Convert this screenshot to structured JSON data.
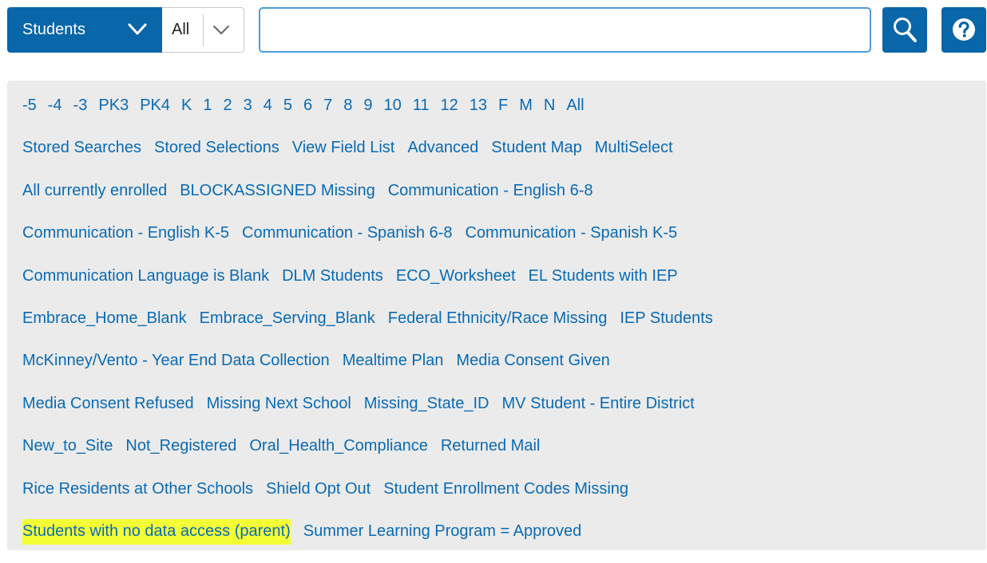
{
  "toolbar": {
    "scope_label": "Students",
    "grade_label": "All",
    "search_value": "",
    "search_icon": "magnifier-icon",
    "help_icon": "question-circle-icon"
  },
  "grade_links": [
    "-5",
    "-4",
    "-3",
    "PK3",
    "PK4",
    "K",
    "1",
    "2",
    "3",
    "4",
    "5",
    "6",
    "7",
    "8",
    "9",
    "10",
    "11",
    "12",
    "13",
    "F",
    "M",
    "N",
    "All"
  ],
  "search_rows": [
    [
      "Stored Searches",
      "Stored Selections",
      "View Field List",
      "Advanced",
      "Student Map",
      "MultiSelect"
    ],
    [
      "All currently enrolled",
      "BLOCKASSIGNED Missing",
      "Communication - English 6-8"
    ],
    [
      "Communication - English K-5",
      "Communication - Spanish 6-8",
      "Communication - Spanish K-5"
    ],
    [
      "Communication Language is Blank",
      "DLM Students",
      "ECO_Worksheet",
      "EL Students with IEP"
    ],
    [
      "Embrace_Home_Blank",
      "Embrace_Serving_Blank",
      "Federal Ethnicity/Race Missing",
      "IEP Students"
    ],
    [
      "McKinney/Vento - Year End Data Collection",
      "Mealtime Plan",
      "Media Consent Given"
    ],
    [
      "Media Consent Refused",
      "Missing Next School",
      "Missing_State_ID",
      "MV Student - Entire District"
    ],
    [
      "New_to_Site",
      "Not_Registered",
      "Oral_Health_Compliance",
      "Returned Mail"
    ],
    [
      "Rice Residents at Other Schools",
      "Shield Opt Out",
      "Student Enrollment Codes Missing"
    ],
    [
      "Students with no data access (parent)",
      "Summer Learning Program = Approved"
    ]
  ],
  "highlighted_link": "Students with no data access (parent)",
  "colors": {
    "primary": "#0966a8",
    "link": "#0a6ab5",
    "panel_bg": "#ebebeb",
    "highlight": "#f4ff36",
    "input_border": "#4a9fdc"
  }
}
